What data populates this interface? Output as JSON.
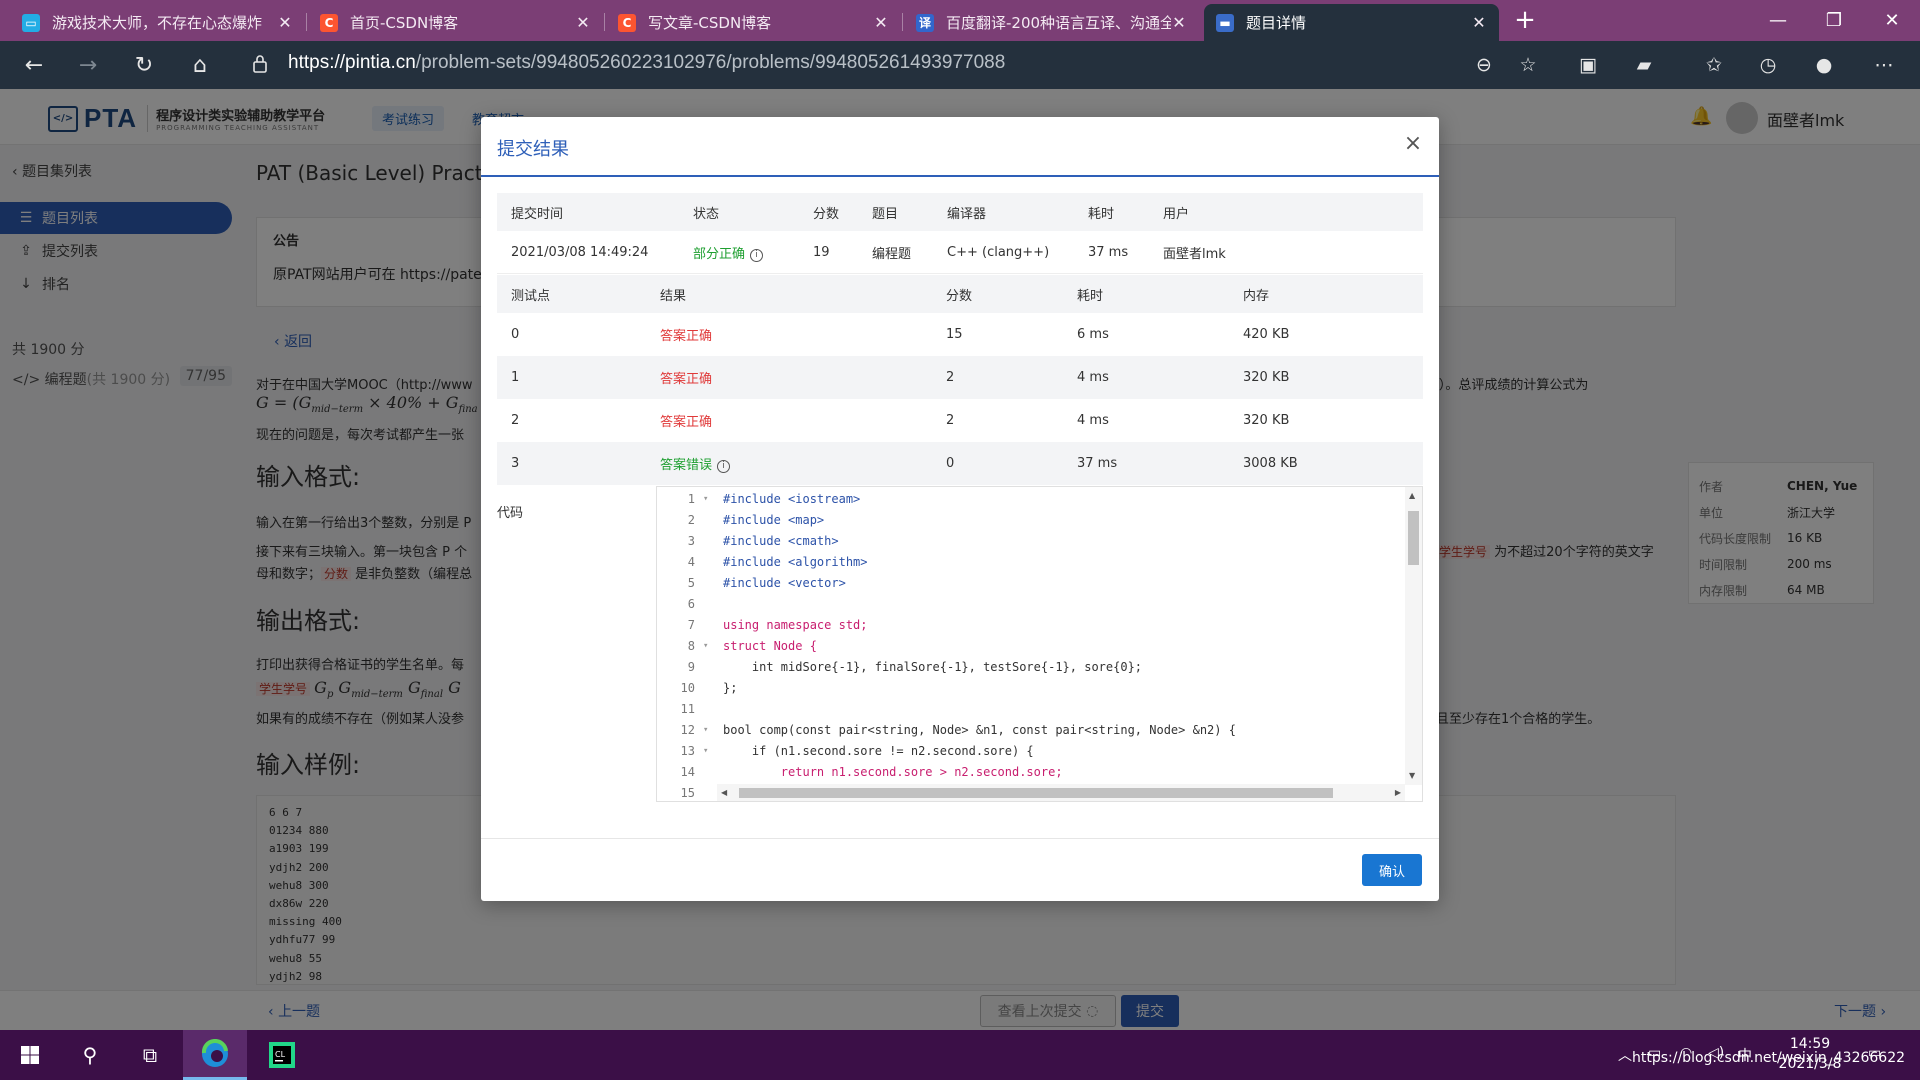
{
  "browser": {
    "tabs": [
      {
        "title": "游戏技术大师，不存在心态爆炸",
        "icon": "bilibili-icon",
        "color": "#23ade5"
      },
      {
        "title": "首页-CSDN博客",
        "icon": "csdn-icon",
        "color": "#fc5531"
      },
      {
        "title": "写文章-CSDN博客",
        "icon": "csdn-icon",
        "color": "#fc5531"
      },
      {
        "title": "百度翻译-200种语言互译、沟通全",
        "icon": "translate-icon",
        "color": "#3266cc"
      },
      {
        "title": "题目详情",
        "icon": "pta-icon",
        "color": "#3a6cc8"
      }
    ],
    "url_host": "https://pintia.cn",
    "url_path": "/problem-sets/994805260223102976/problems/994805261493977088"
  },
  "site": {
    "logo_text": "PTA",
    "logo_subtitle": "程序设计类实验辅助教学平台",
    "logo_subtitle_en": "PROGRAMMING TEACHING ASSISTANT",
    "nav": [
      "考试练习",
      "教育超市"
    ],
    "username": "面壁者lmk"
  },
  "sidebar": {
    "back": "题目集列表",
    "items": [
      {
        "label": "题目列表",
        "icon": "list-icon",
        "active": true
      },
      {
        "label": "提交列表",
        "icon": "upload-icon",
        "active": false
      },
      {
        "label": "排名",
        "icon": "ranking-icon",
        "active": false
      }
    ],
    "total_score": "共 1900 分",
    "program_label": "编程题",
    "program_score": "(共 1900 分)",
    "program_count": "77/95"
  },
  "main": {
    "title": "PAT (Basic Level) Practic",
    "notice_heading": "公告",
    "notice_text": "原PAT网站用户可在 https://pate",
    "back_link": "返回",
    "para1": "对于在中国大学MOOC（http://www",
    "para1_tail": "分100）。总评成绩的计算公式为",
    "formula": "G = (G",
    "formula_sub1": "mid−term",
    "formula_mid": " × 40% + G",
    "formula_sub2": "fina",
    "para2": "现在的问题是，每次考试都产生一张",
    "h_input": "输入格式:",
    "input1": "输入在第一行给出3个整数，分别是 P",
    "input2": "接下来有三块输入。第一块包含 P 个",
    "input2_tag": "学生学号",
    "input2_tail": "为不超过20个字符的英文字",
    "input3": "母和数字；",
    "input3_tag": "分数",
    "input3_tail": "是非负整数（编程总",
    "h_output": "输出格式:",
    "output1": "打印出获得合格证书的学生名单。每",
    "output2_tag": "学生学号",
    "output2_math": "G",
    "output3": "如果有的成绩不存在（例如某人没参",
    "output3_tail": "且至少存在1个合格的学生。",
    "h_sample": "输入样例:",
    "sample_lines": [
      "6 6 7",
      "01234 880",
      "a1903 199",
      "ydjh2 200",
      "wehu8 300",
      "dx86w 220",
      "missing 400",
      "ydhfu77 99",
      "wehu8 55",
      "ydjh2 98"
    ]
  },
  "info_panel": [
    {
      "k": "作者",
      "v": "CHEN, Yue",
      "bold": true
    },
    {
      "k": "单位",
      "v": "浙江大学",
      "bold": false
    },
    {
      "k": "代码长度限制",
      "v": "16 KB",
      "bold": false
    },
    {
      "k": "时间限制",
      "v": "200 ms",
      "bold": false
    },
    {
      "k": "内存限制",
      "v": "64 MB",
      "bold": false
    }
  ],
  "bottom": {
    "prev": "上一题",
    "next": "下一题",
    "view_last": "查看上次提交",
    "submit": "提交"
  },
  "modal": {
    "title": "提交结果",
    "summary_headers": [
      "提交时间",
      "状态",
      "分数",
      "题目",
      "编译器",
      "耗时",
      "用户"
    ],
    "summary": {
      "time": "2021/03/08 14:49:24",
      "status": "部分正确",
      "score": "19",
      "type": "编程题",
      "compiler": "C++ (clang++)",
      "elapsed": "37 ms",
      "user": "面壁者lmk"
    },
    "case_headers": [
      "测试点",
      "结果",
      "分数",
      "耗时",
      "内存"
    ],
    "cases": [
      {
        "id": "0",
        "result": "答案正确",
        "ok": true,
        "score": "15",
        "time": "6 ms",
        "mem": "420 KB"
      },
      {
        "id": "1",
        "result": "答案正确",
        "ok": true,
        "score": "2",
        "time": "4 ms",
        "mem": "320 KB"
      },
      {
        "id": "2",
        "result": "答案正确",
        "ok": true,
        "score": "2",
        "time": "4 ms",
        "mem": "320 KB"
      },
      {
        "id": "3",
        "result": "答案错误",
        "ok": false,
        "score": "0",
        "time": "37 ms",
        "mem": "3008 KB"
      }
    ],
    "code_label": "代码",
    "code_lines": [
      "#include <iostream>",
      "#include <map>",
      "#include <cmath>",
      "#include <algorithm>",
      "#include <vector>",
      "",
      "using namespace std;",
      "struct Node {",
      "    int midSore{-1}, finalSore{-1}, testSore{-1}, sore{0};",
      "};",
      "",
      "bool comp(const pair<string, Node> &n1, const pair<string, Node> &n2) {",
      "    if (n1.second.sore != n2.second.sore) {",
      "        return n1.second.sore > n2.second.sore;",
      ""
    ],
    "ok_button": "确认"
  },
  "taskbar": {
    "clock_time": "14:59",
    "clock_date": "2021/3/8",
    "ime": "中",
    "watermark": "https://blog.csdn.net/weixin_43266622"
  }
}
